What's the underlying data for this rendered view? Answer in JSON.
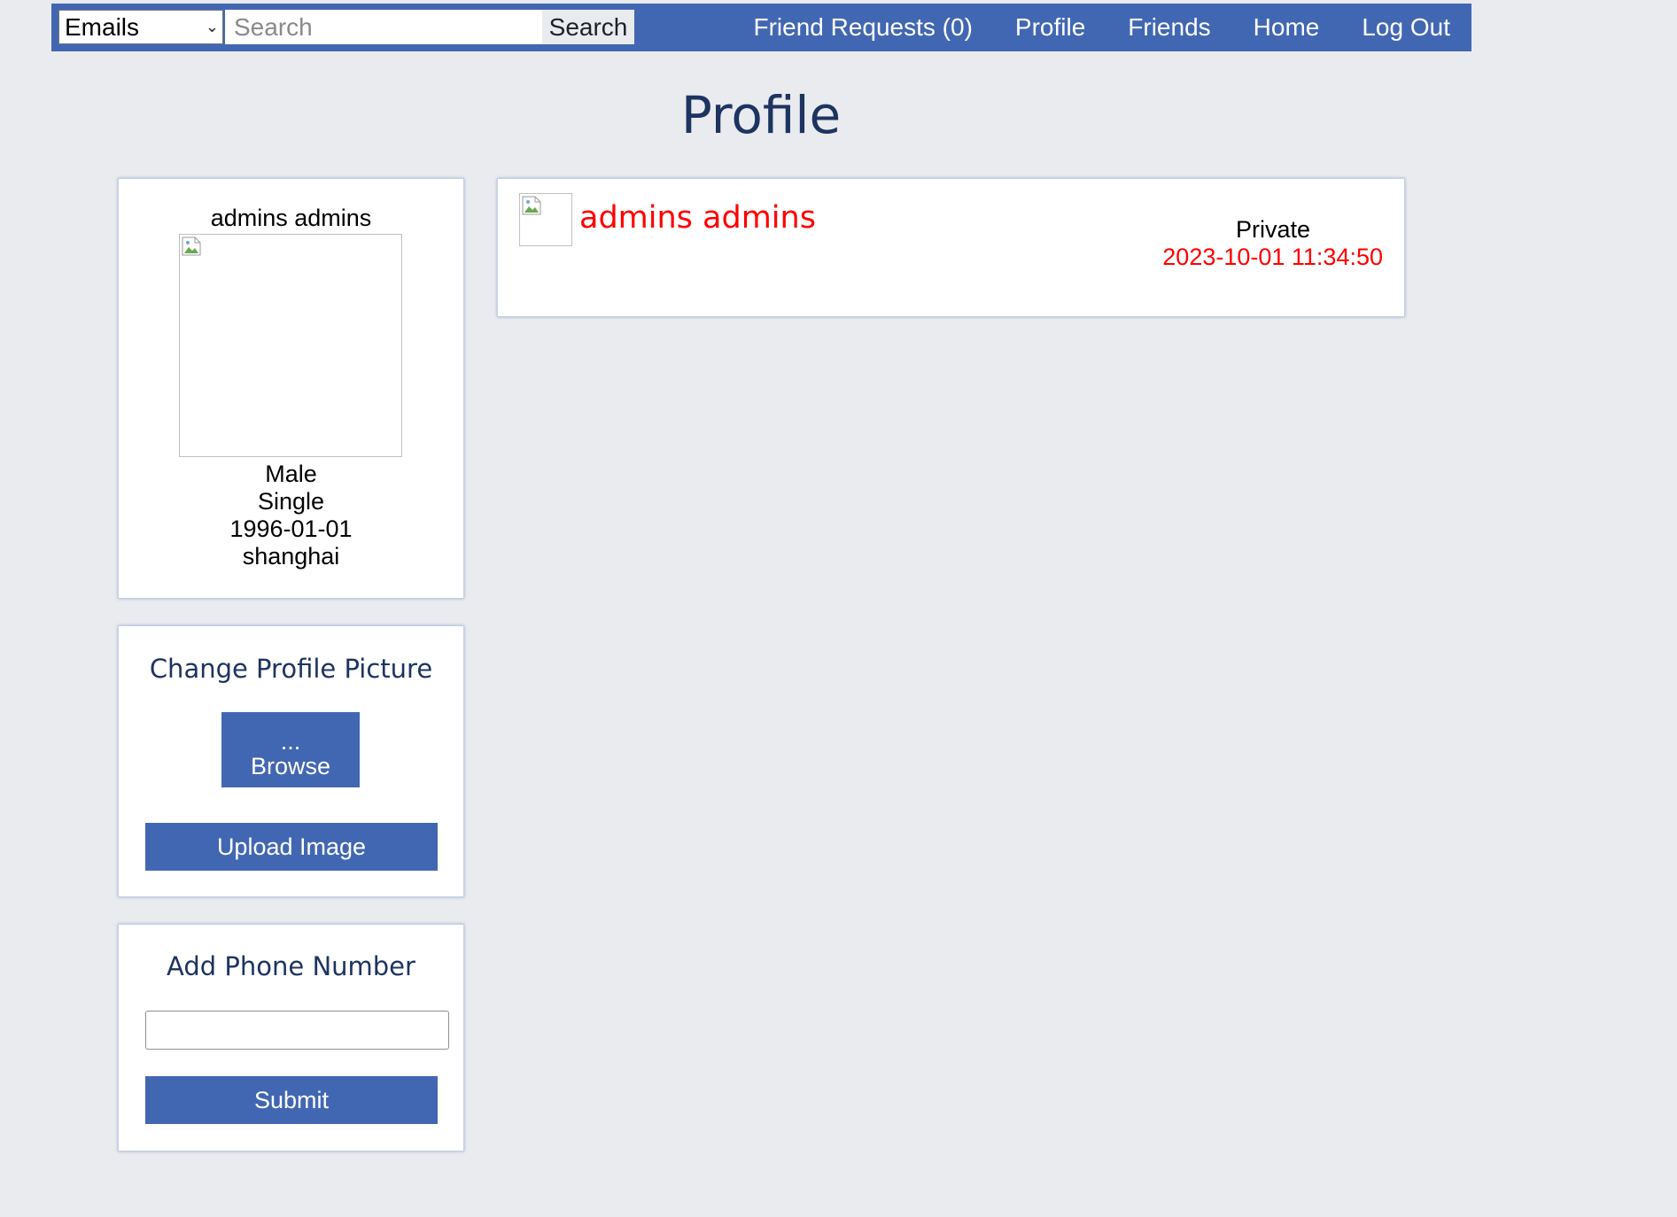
{
  "header": {
    "search_type": "Emails",
    "search_placeholder": "Search",
    "search_button": "Search",
    "nav": [
      {
        "label": "Friend Requests (0)"
      },
      {
        "label": "Profile"
      },
      {
        "label": "Friends"
      },
      {
        "label": "Home"
      },
      {
        "label": "Log Out"
      }
    ]
  },
  "page_title": "Profile",
  "profile": {
    "name": "admins admins",
    "gender": "Male",
    "status": "Single",
    "birthday": "1996-01-01",
    "location": "shanghai"
  },
  "change_picture": {
    "heading": "Change Profile Picture",
    "browse_dots": "...",
    "browse_label": "Browse",
    "upload_label": "Upload Image"
  },
  "phone": {
    "heading": "Add Phone Number",
    "value": "",
    "submit_label": "Submit"
  },
  "post": {
    "author": "admins admins",
    "privacy": "Private",
    "date": "2023-10-01 11:34:50"
  },
  "colors": {
    "brand": "#4267b2",
    "background": "#e9ebee",
    "heading": "#1d3461",
    "highlight": "#ff0000"
  }
}
